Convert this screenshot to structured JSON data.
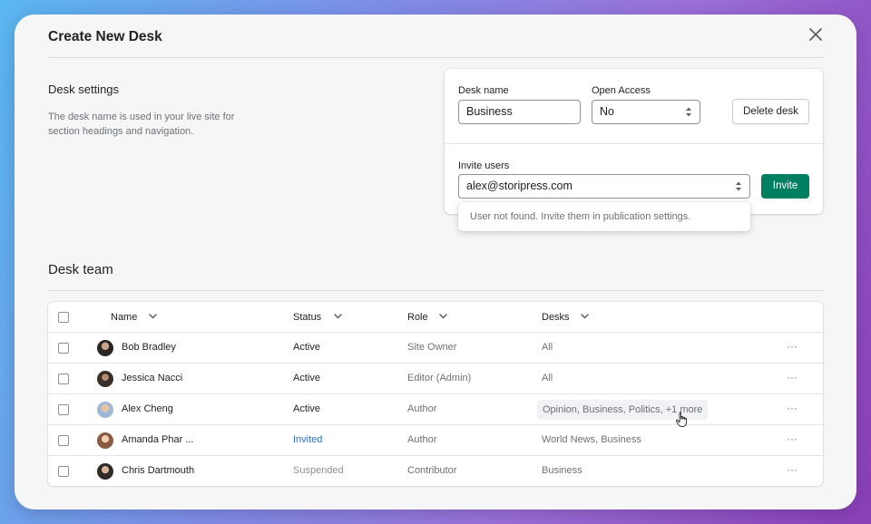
{
  "dialog": {
    "title": "Create New Desk",
    "close_icon": "close-icon"
  },
  "settings": {
    "title": "Desk settings",
    "description": "The desk name is used in your live site for section headings and navigation."
  },
  "form": {
    "desk_name_label": "Desk name",
    "desk_name_value": "Business",
    "open_access_label": "Open Access",
    "open_access_value": "No",
    "delete_button": "Delete desk",
    "invite_label": "Invite users",
    "invite_value": "alex@storipress.com",
    "invite_button": "Invite",
    "popover_message": "User not found. Invite them in publication settings."
  },
  "team": {
    "title": "Desk team",
    "columns": [
      "Name",
      "Status",
      "Role",
      "Desks"
    ],
    "rows": [
      {
        "name": "Bob Bradley",
        "status": "Active",
        "role": "Site Owner",
        "desks": "All"
      },
      {
        "name": "Jessica Nacci",
        "status": "Active",
        "role": "Editor (Admin)",
        "desks": "All"
      },
      {
        "name": "Alex Cheng",
        "status": "Active",
        "role": "Author",
        "desks": "Opinion, Business, Politics, +1 more"
      },
      {
        "name": "Amanda Phar ...",
        "status": "Invited",
        "role": "Author",
        "desks": "World News, Business"
      },
      {
        "name": "Chris Dartmouth",
        "status": "Suspended",
        "role": "Contributor",
        "desks": "Business"
      }
    ],
    "row_action": "···"
  },
  "colors": {
    "primary": "#008060",
    "invited": "#2c6ecb",
    "suspended": "#8c9196"
  }
}
